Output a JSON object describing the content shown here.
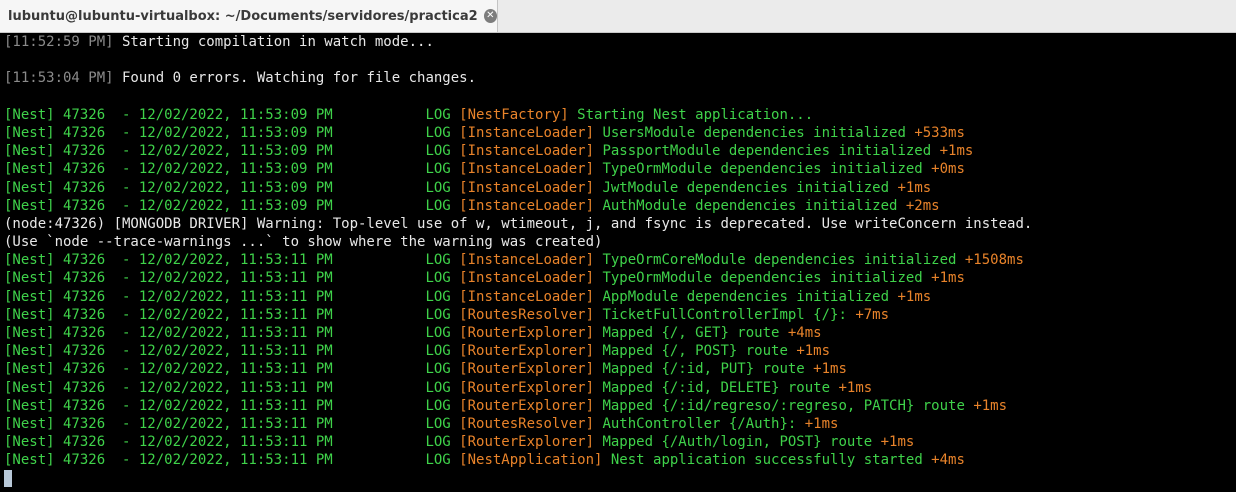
{
  "window": {
    "tab_title": "lubuntu@lubuntu-virtualbox: ~/Documents/servidores/practica2",
    "close_glyph": "✕"
  },
  "terminal": {
    "lines": [
      {
        "type": "plain",
        "segments": [
          [
            "gr",
            "[11:52:59 PM]"
          ],
          [
            "w",
            " Starting compilation in watch mode..."
          ]
        ]
      },
      {
        "type": "blank"
      },
      {
        "type": "plain",
        "segments": [
          [
            "gr",
            "[11:53:04 PM]"
          ],
          [
            "w",
            " Found 0 errors. Watching for file changes."
          ]
        ]
      },
      {
        "type": "blank"
      },
      {
        "type": "nest",
        "time": "11:53:09 PM",
        "ctx": "[NestFactory]",
        "msg": "Starting Nest application..."
      },
      {
        "type": "nest",
        "time": "11:53:09 PM",
        "ctx": "[InstanceLoader]",
        "msg": "UsersModule dependencies initialized",
        "ms": "+533ms"
      },
      {
        "type": "nest",
        "time": "11:53:09 PM",
        "ctx": "[InstanceLoader]",
        "msg": "PassportModule dependencies initialized",
        "ms": "+1ms"
      },
      {
        "type": "nest",
        "time": "11:53:09 PM",
        "ctx": "[InstanceLoader]",
        "msg": "TypeOrmModule dependencies initialized",
        "ms": "+0ms"
      },
      {
        "type": "nest",
        "time": "11:53:09 PM",
        "ctx": "[InstanceLoader]",
        "msg": "JwtModule dependencies initialized",
        "ms": "+1ms"
      },
      {
        "type": "nest",
        "time": "11:53:09 PM",
        "ctx": "[InstanceLoader]",
        "msg": "AuthModule dependencies initialized",
        "ms": "+2ms"
      },
      {
        "type": "plain",
        "segments": [
          [
            "w",
            "(node:47326) [MONGODB DRIVER] Warning: Top-level use of w, wtimeout, j, and fsync is deprecated. Use writeConcern instead."
          ]
        ]
      },
      {
        "type": "plain",
        "segments": [
          [
            "w",
            "(Use `node --trace-warnings ...` to show where the warning was created)"
          ]
        ]
      },
      {
        "type": "nest",
        "time": "11:53:11 PM",
        "ctx": "[InstanceLoader]",
        "msg": "TypeOrmCoreModule dependencies initialized",
        "ms": "+1508ms"
      },
      {
        "type": "nest",
        "time": "11:53:11 PM",
        "ctx": "[InstanceLoader]",
        "msg": "TypeOrmModule dependencies initialized",
        "ms": "+1ms"
      },
      {
        "type": "nest",
        "time": "11:53:11 PM",
        "ctx": "[InstanceLoader]",
        "msg": "AppModule dependencies initialized",
        "ms": "+1ms"
      },
      {
        "type": "nest",
        "time": "11:53:11 PM",
        "ctx": "[RoutesResolver]",
        "msg": "TicketFullControllerImpl {/}:",
        "ms": "+7ms"
      },
      {
        "type": "nest",
        "time": "11:53:11 PM",
        "ctx": "[RouterExplorer]",
        "msg": "Mapped {/, GET} route",
        "ms": "+4ms"
      },
      {
        "type": "nest",
        "time": "11:53:11 PM",
        "ctx": "[RouterExplorer]",
        "msg": "Mapped {/, POST} route",
        "ms": "+1ms"
      },
      {
        "type": "nest",
        "time": "11:53:11 PM",
        "ctx": "[RouterExplorer]",
        "msg": "Mapped {/:id, PUT} route",
        "ms": "+1ms"
      },
      {
        "type": "nest",
        "time": "11:53:11 PM",
        "ctx": "[RouterExplorer]",
        "msg": "Mapped {/:id, DELETE} route",
        "ms": "+1ms"
      },
      {
        "type": "nest",
        "time": "11:53:11 PM",
        "ctx": "[RouterExplorer]",
        "msg": "Mapped {/:id/regreso/:regreso, PATCH} route",
        "ms": "+1ms"
      },
      {
        "type": "nest",
        "time": "11:53:11 PM",
        "ctx": "[RoutesResolver]",
        "msg": "AuthController {/Auth}:",
        "ms": "+1ms"
      },
      {
        "type": "nest",
        "time": "11:53:11 PM",
        "ctx": "[RouterExplorer]",
        "msg": "Mapped {/Auth/login, POST} route",
        "ms": "+1ms"
      },
      {
        "type": "nest",
        "time": "11:53:11 PM",
        "ctx": "[NestApplication]",
        "msg": "Nest application successfully started",
        "ms": "+4ms"
      }
    ],
    "nest_prefix": "[Nest] 47326  - 12/02/2022, ",
    "log_level": "LOG"
  }
}
